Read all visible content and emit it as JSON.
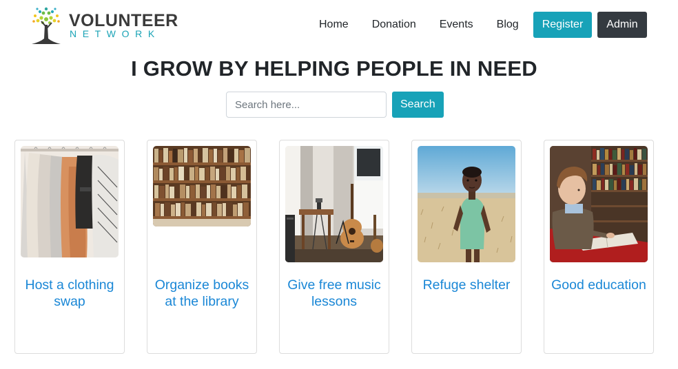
{
  "brand": {
    "name_line1": "VOLUNTEER",
    "name_line2": "NETWORK",
    "accent_color": "#1aa3b6",
    "tree_color": "#3a3a3a"
  },
  "nav": {
    "links": [
      "Home",
      "Donation",
      "Events",
      "Blog"
    ],
    "register_label": "Register",
    "admin_label": "Admin",
    "register_color": "#17a2b8",
    "admin_color": "#343a40"
  },
  "hero": {
    "headline": "I GROW BY HELPING PEOPLE IN NEED"
  },
  "search": {
    "placeholder": "Search here...",
    "value": "",
    "button_label": "Search"
  },
  "cards": [
    {
      "title": "Host a clothing swap",
      "image": "clothes-rack-photo"
    },
    {
      "title": "Organize books at the library",
      "image": "bookshelf-photo"
    },
    {
      "title": "Give free music lessons",
      "image": "guitar-room-photo"
    },
    {
      "title": "Refuge shelter",
      "image": "child-field-photo"
    },
    {
      "title": "Good education",
      "image": "boy-reading-photo"
    }
  ],
  "card_title_color": "#1a87d6"
}
